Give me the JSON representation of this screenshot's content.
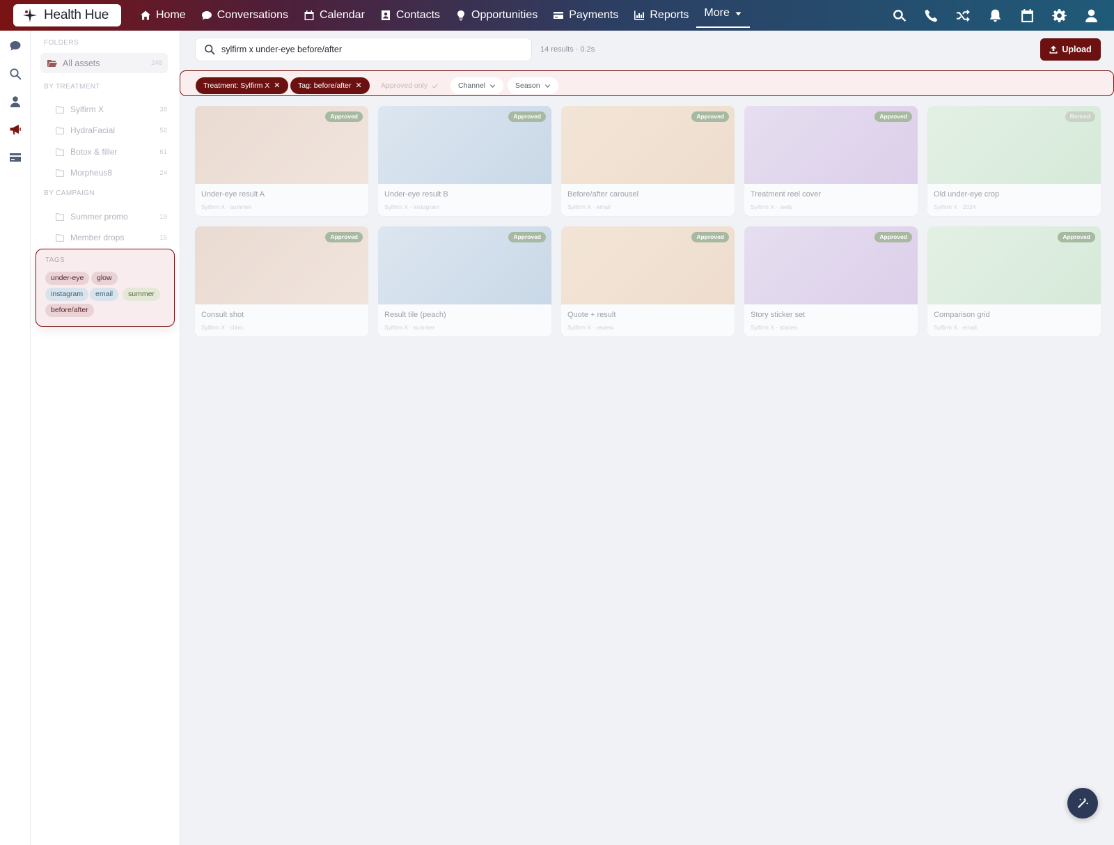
{
  "app": {
    "name": "Health Hue"
  },
  "nav": {
    "items": [
      {
        "label": "Home",
        "icon": "home-icon"
      },
      {
        "label": "Conversations",
        "icon": "chat-bubble-icon"
      },
      {
        "label": "Calendar",
        "icon": "calendar-icon"
      },
      {
        "label": "Contacts",
        "icon": "contact-card-icon"
      },
      {
        "label": "Opportunities",
        "icon": "lightbulb-icon"
      },
      {
        "label": "Payments",
        "icon": "credit-card-icon"
      },
      {
        "label": "Reports",
        "icon": "bar-chart-icon"
      }
    ],
    "more_label": "More",
    "right_icons": [
      "search-icon",
      "phone-icon",
      "shuffle-icon",
      "bell-icon",
      "calendar-icon",
      "gear-icon",
      "user-icon"
    ]
  },
  "rail": {
    "icons": [
      "chat-icon",
      "search-icon",
      "user-icon",
      "megaphone-icon",
      "card-icon"
    ],
    "active": "megaphone-icon"
  },
  "sidebar": {
    "folders_label": "FOLDERS",
    "all_assets": {
      "label": "All assets",
      "count": "248"
    },
    "by_treatment_label": "BY TREATMENT",
    "treatments": [
      {
        "label": "Sylfirm X",
        "count": "38"
      },
      {
        "label": "HydraFacial",
        "count": "52"
      },
      {
        "label": "Botox & filler",
        "count": "61"
      },
      {
        "label": "Morpheus8",
        "count": "24"
      }
    ],
    "by_campaign_label": "BY CAMPAIGN",
    "campaigns": [
      {
        "label": "Summer promo",
        "count": "19"
      },
      {
        "label": "Member drops",
        "count": "15"
      }
    ],
    "tags_label": "TAGS",
    "tags": [
      {
        "label": "under-eye",
        "color": "red"
      },
      {
        "label": "glow",
        "color": "red"
      },
      {
        "label": "instagram",
        "color": "blue"
      },
      {
        "label": "email",
        "color": "blue"
      },
      {
        "label": "summer",
        "color": "green"
      },
      {
        "label": "before/after",
        "color": "red"
      }
    ]
  },
  "search": {
    "query": "sylfirm x under-eye before/after",
    "results": "14 results · 0.2s"
  },
  "upload_label": "Upload",
  "filters": {
    "active": [
      {
        "label": "Treatment: Sylfirm X"
      },
      {
        "label": "Tag: before/after"
      }
    ],
    "approved_only": "Approved only",
    "channel": "Channel",
    "season": "Season"
  },
  "assets": [
    {
      "name": "Under-eye result A",
      "meta": "Sylfirm X · summer",
      "status": "Approved",
      "tone": "peach"
    },
    {
      "name": "Under-eye result B",
      "meta": "Sylfirm X · instagram",
      "status": "Approved",
      "tone": "blue"
    },
    {
      "name": "Before/after carousel",
      "meta": "Sylfirm X · email",
      "status": "Approved",
      "tone": "apricot"
    },
    {
      "name": "Treatment reel cover",
      "meta": "Sylfirm X · reels",
      "status": "Approved",
      "tone": "lilac"
    },
    {
      "name": "Old under-eye crop",
      "meta": "Sylfirm X · 2024",
      "status": "Retired",
      "tone": "mint"
    },
    {
      "name": "Consult shot",
      "meta": "Sylfirm X · clinic",
      "status": "Approved",
      "tone": "peach"
    },
    {
      "name": "Result tile (peach)",
      "meta": "Sylfirm X · summer",
      "status": "Approved",
      "tone": "blue"
    },
    {
      "name": "Quote + result",
      "meta": "Sylfirm X · review",
      "status": "Approved",
      "tone": "apricot"
    },
    {
      "name": "Story sticker set",
      "meta": "Sylfirm X · stories",
      "status": "Approved",
      "tone": "lilac"
    },
    {
      "name": "Comparison grid",
      "meta": "Sylfirm X · email",
      "status": "Approved",
      "tone": "mint"
    }
  ],
  "colors": {
    "brand": "#6b1111",
    "approved_badge": "#a7b9a1",
    "peach": "#ecdfd6",
    "blue": "#d3dfe9",
    "apricot": "#f1e2d3",
    "lilac": "#e2d9ee",
    "mint": "#dcecde"
  },
  "fab": {
    "icon": "magic-wand-icon"
  }
}
